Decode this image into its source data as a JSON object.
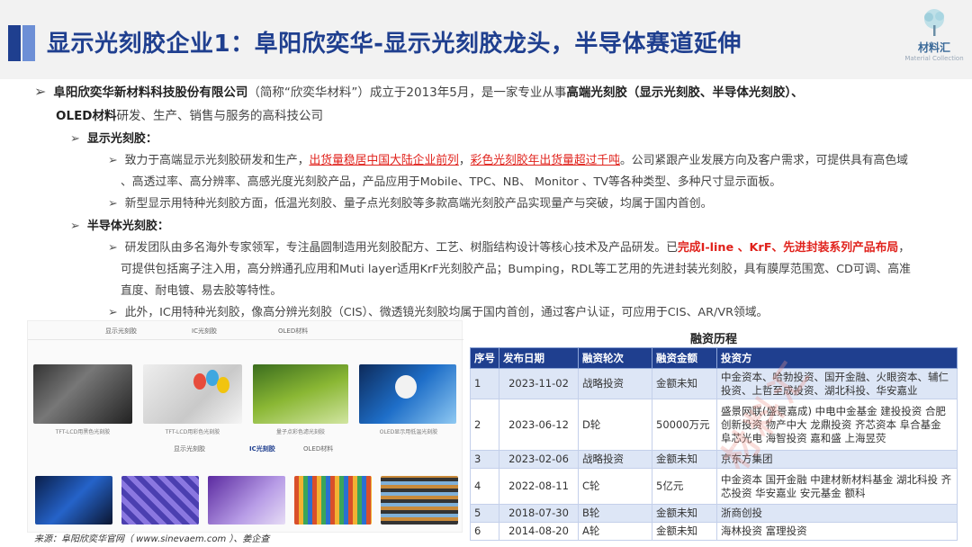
{
  "header": {
    "title": "显示光刻胶企业1：阜阳欣奕华-显示光刻胶龙头，半导体赛道延伸",
    "logo_name": "材料汇",
    "logo_sub": "Material Collection",
    "logo_icon": "tree-icon"
  },
  "intro": {
    "company": "阜阳欣奕华新材料科技股份有限公司",
    "text1": "（简称“欣奕华材料”）成立于2013年5月，是一家专业从事",
    "highlight": "高端光刻胶（显示光刻胶、半导体光刻胶）、",
    "line2_bold": "OLED材料",
    "line2_text": "研发、生产、销售与服务的高科技公司"
  },
  "display_section": {
    "heading": "显示光刻胶：",
    "p1_a": "致力于高端显示光刻胶研发和生产，",
    "p1_red1": "出货量稳居中国大陆企业前列",
    "p1_sep": "，",
    "p1_red2": "彩色光刻胶年出货量超过千吨",
    "p1_b": "。公司紧跟产业发展方向及客户需求，可提供具有高色域",
    "p1_c": "、高透过率、高分辨率、高感光度光刻胶产品，产品应用于Mobile、TPC、NB、 Monitor 、TV等各种类型、多种尺寸显示面板。",
    "p2": "新型显示用特种光刻胶方面，低温光刻胶、量子点光刻胶等多款高端光刻胶产品实现量产与突破，均属于国内首创。"
  },
  "semi_section": {
    "heading": "半导体光刻胶：",
    "p1_a": "研发团队由多名海外专家领军，专注晶圆制造用光刻胶配方、工艺、树脂结构设计等核心技术及产品研发。已",
    "p1_red": "完成I-line 、KrF、先进封装系列产品布局",
    "p1_end": "，",
    "p1_b": "可提供包括离子注入用，高分辨通孔应用和Muti layer适用KrF光刻胶产品；Bumping，RDL等工艺用的先进封装光刻胶，具有膜厚范围宽、CD可调、高准",
    "p1_c": "直度、耐电镀、易去胶等特性。",
    "p2": "此外，IC用特种光刻胶，像高分辨光刻胶（CIS）、微透镜光刻胶均属于国内首创，通过客户认证，可应用于CIS、AR/VR领域。"
  },
  "gallery": {
    "top_tabs": [
      "显示光刻胶",
      "IC光刻胶",
      "OLED材料"
    ],
    "top_captions": [
      "TFT-LCD用黑色光刻胶",
      "TFT-LCD用彩色光刻胶",
      "量子点彩色滤光刻胶",
      "OLED显示用低温光刻胶"
    ],
    "bottom_tabs": [
      "显示光刻胶",
      "IC光刻胶",
      "OLED材料"
    ],
    "bottom_captions": [
      "",
      "",
      "",
      "",
      ""
    ],
    "source": "来源：阜阳欣奕华官网（ www.sinevaem.com ）、姜企查"
  },
  "funding": {
    "title": "融资历程",
    "headers": [
      "序号",
      "发布日期",
      "融资轮次",
      "融资金额",
      "投资方"
    ],
    "rows": [
      [
        "1",
        "2023-11-02",
        "战略投资",
        "金额未知",
        "中金资本、哈勃投资、国开金融、火眼资本、辅仁投资、上哲至成投资、湖北科投、华安嘉业"
      ],
      [
        "2",
        "2023-06-12",
        "D轮",
        "50000万元",
        "盛景网联(盛景嘉成) 中电中金基金 建投投资 合肥创新投资 物产中大 龙鼎投资 齐芯资本 阜合基金 阜芯光电 海智投资 嘉和盛 上海昱荧"
      ],
      [
        "3",
        "2023-02-06",
        "战略投资",
        "金额未知",
        "京东方集团"
      ],
      [
        "4",
        "2022-08-11",
        "C轮",
        "5亿元",
        "中金资本 国开金融 中建材新材料基金 湖北科投 齐芯投资 华安嘉业 安元基金 额科"
      ],
      [
        "5",
        "2018-07-30",
        "B轮",
        "金额未知",
        "浙商创投"
      ],
      [
        "6",
        "2014-08-20",
        "A轮",
        "金额未知",
        "海林投资 富理投资"
      ]
    ]
  },
  "watermark": "材料汇"
}
